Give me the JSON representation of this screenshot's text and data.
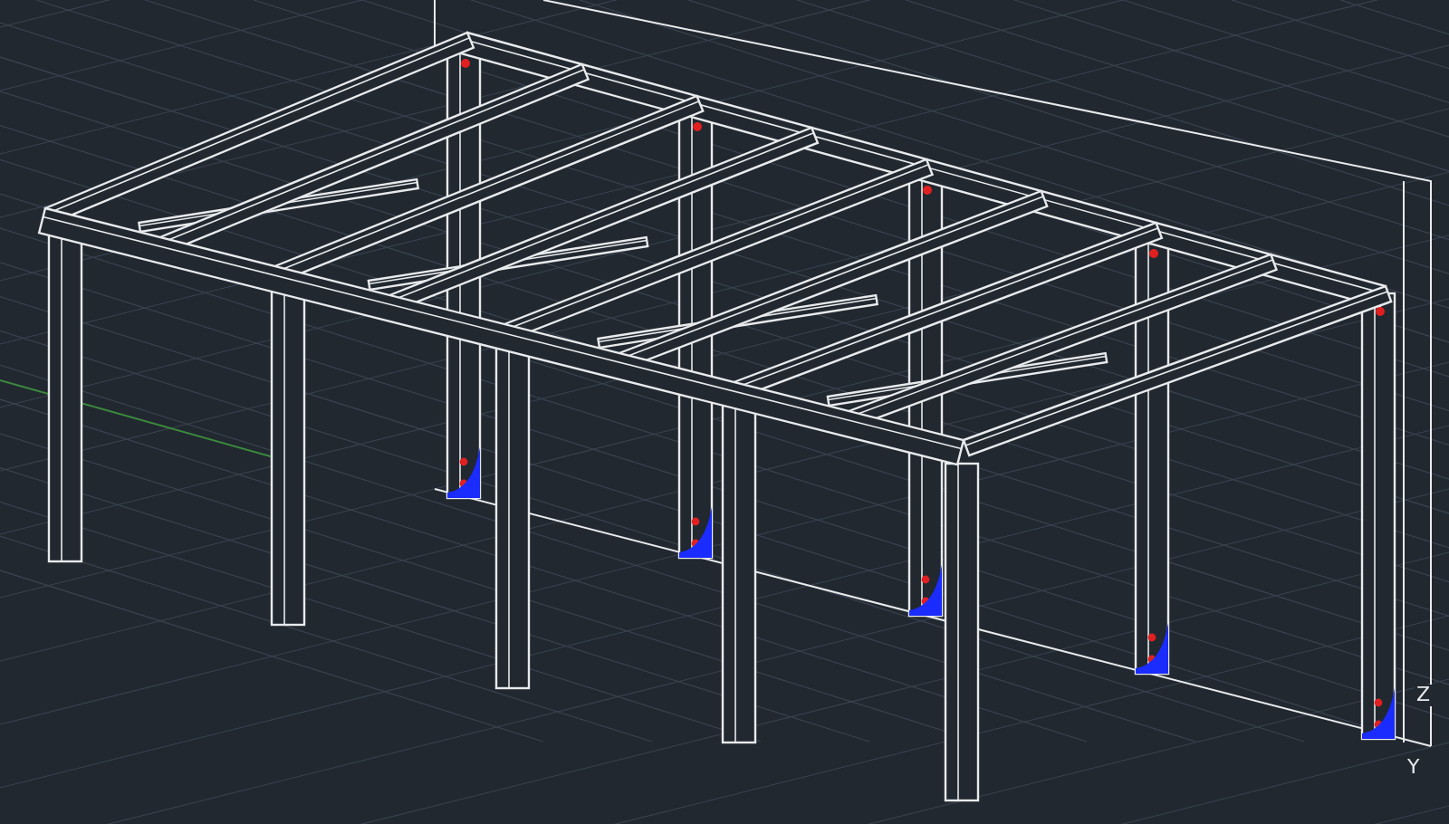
{
  "viewport": {
    "axis_labels": [
      {
        "text": "Z"
      },
      {
        "text": "Y"
      }
    ]
  }
}
